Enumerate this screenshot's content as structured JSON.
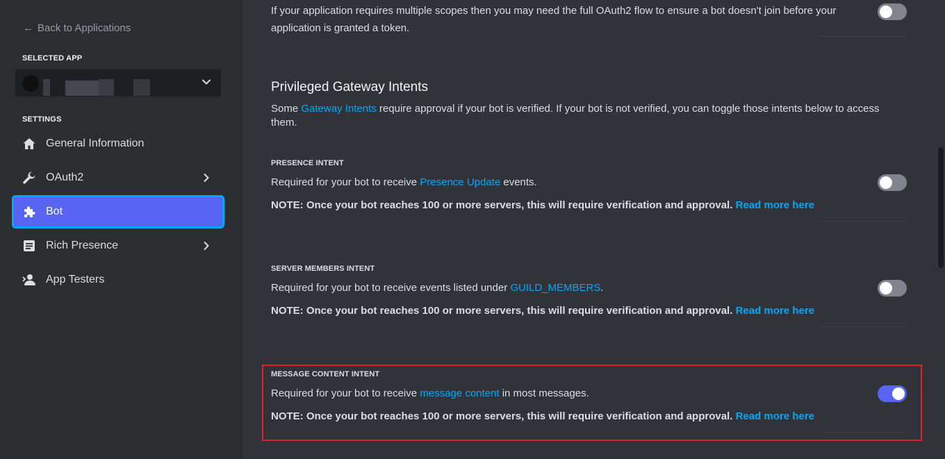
{
  "sidebar": {
    "back_label": "Back to Applications",
    "selected_app_label": "SELECTED APP",
    "settings_label": "SETTINGS",
    "items": [
      {
        "label": "General Information",
        "icon": "home-icon"
      },
      {
        "label": "OAuth2",
        "icon": "wrench-icon"
      },
      {
        "label": "Bot",
        "icon": "puzzle-icon",
        "active": true
      },
      {
        "label": "Rich Presence",
        "icon": "document-icon"
      },
      {
        "label": "App Testers",
        "icon": "person-icon"
      }
    ]
  },
  "main": {
    "top_text_line1": "If your application requires multiple scopes then you may need the full OAuth2 flow to ensure a bot doesn't join before your",
    "top_text_line2": "application is granted a token.",
    "heading": "Privileged Gateway Intents",
    "desc_prefix": "Some ",
    "desc_link": "Gateway Intents",
    "desc_suffix_line1": " require approval if your bot is verified. If your bot is not verified, you can toggle those intents below to access",
    "desc_suffix_line2": "them.",
    "intents": [
      {
        "title": "PRESENCE INTENT",
        "desc_prefix": "Required for your bot to receive ",
        "desc_link": "Presence Update",
        "desc_suffix": " events.",
        "note": "NOTE: Once your bot reaches 100 or more servers, this will require verification and approval.",
        "note_link": "Read more here",
        "enabled": false
      },
      {
        "title": "SERVER MEMBERS INTENT",
        "desc_prefix": "Required for your bot to receive events listed under ",
        "desc_link": "GUILD_MEMBERS",
        "desc_suffix": ".",
        "note": "NOTE: Once your bot reaches 100 or more servers, this will require verification and approval.",
        "note_link": "Read more here",
        "enabled": false
      },
      {
        "title": "MESSAGE CONTENT INTENT",
        "desc_prefix": "Required for your bot to receive ",
        "desc_link": "message content",
        "desc_suffix": " in most messages.",
        "note": "NOTE: Once your bot reaches 100 or more servers, this will require verification and approval.",
        "note_link": "Read more here",
        "enabled": true
      }
    ]
  },
  "colors": {
    "accent": "#5865f2",
    "link": "#00a8fc",
    "highlight": "#e0202a"
  }
}
